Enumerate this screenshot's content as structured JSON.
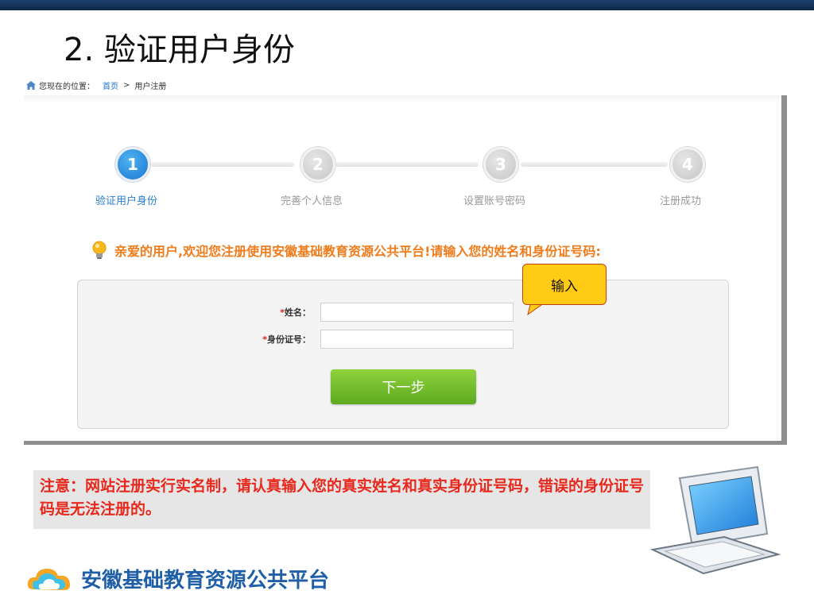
{
  "slide": {
    "title": "2. 验证用户身份"
  },
  "breadcrumb": {
    "prefix": "您现在的位置：",
    "home": "首页",
    "separator": ">",
    "current": "用户注册"
  },
  "steps": [
    {
      "number": "1",
      "label": "验证用户身份",
      "active": true
    },
    {
      "number": "2",
      "label": "完善个人信息",
      "active": false
    },
    {
      "number": "3",
      "label": "设置账号密码",
      "active": false
    },
    {
      "number": "4",
      "label": "注册成功",
      "active": false
    }
  ],
  "welcome": "亲爱的用户,欢迎您注册使用安徽基础教育资源公共平台!请输入您的姓名和身份证号码:",
  "form": {
    "required_mark": "*",
    "name_label": "姓名：",
    "name_value": "",
    "id_label": "身份证号：",
    "id_value": "",
    "next_button": "下一步"
  },
  "callout": "输入",
  "notice": "注意：网站注册实行实名制，请认真输入您的真实姓名和真实身份证号码，错误的身份证号码是无法注册的。",
  "footer": {
    "platform_name": "安徽基础教育资源公共平台"
  },
  "colors": {
    "accent_blue": "#1a77d2",
    "orange_text": "#f07c1c",
    "notice_red": "#e8281c",
    "button_green": "#6cb82a",
    "callout_yellow": "#ffcb14",
    "header_bar": "#0e2748"
  },
  "icons": {
    "breadcrumb": "home-icon",
    "welcome": "lightbulb-icon",
    "footer": "cloud-logo-icon",
    "illustration": "computer-icon"
  }
}
